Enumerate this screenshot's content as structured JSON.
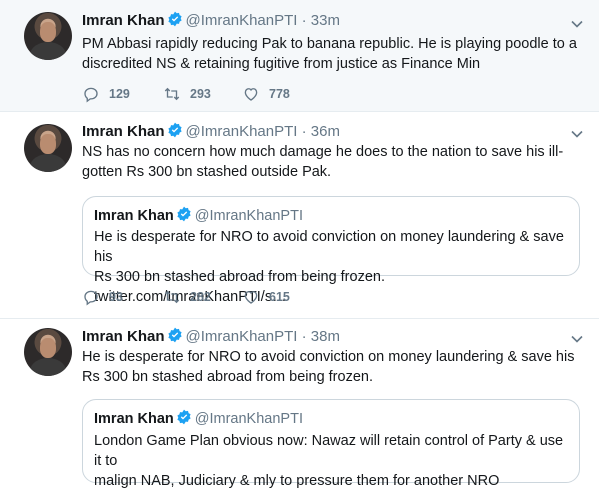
{
  "tweets": [
    {
      "name": "Imran Khan",
      "handle": "@ImranKhanPTI",
      "time": "33m",
      "text_line1": "PM Abbasi rapidly reducing Pak to banana republic. He is playing poodle to a",
      "text_line2": "discredited NS & retaining fugitive from justice as Finance Min",
      "replies": "129",
      "retweets": "293",
      "likes": "778"
    },
    {
      "name": "Imran Khan",
      "handle": "@ImranKhanPTI",
      "time": "36m",
      "text_line1": "NS has no concern how much damage he does to the nation to save his ill-",
      "text_line2": "gotten Rs 300 bn stashed outside Pak.",
      "quote": {
        "name": "Imran Khan",
        "handle": "@ImranKhanPTI",
        "text_line1": "He is desperate for NRO to avoid conviction on money laundering & save his",
        "text_line2": "Rs 300 bn stashed abroad from being frozen. twitter.com/ImranKhanPTI/s…"
      },
      "replies": "93",
      "retweets": "282",
      "likes": "615"
    },
    {
      "name": "Imran Khan",
      "handle": "@ImranKhanPTI",
      "time": "38m",
      "text_line1": "He is desperate for NRO to avoid conviction on money laundering & save his",
      "text_line2": "Rs 300 bn stashed abroad from being frozen.",
      "quote": {
        "name": "Imran Khan",
        "handle": "@ImranKhanPTI",
        "text_line1": "London Game Plan obvious now: Nawaz will retain control of Party & use it to",
        "text_line2": "malign NAB, Judiciary & mly to pressure them for another NRO"
      }
    }
  ],
  "separator": "·",
  "colors": {
    "verified": "#1da1f2",
    "muted": "#657786",
    "highlight_bg": "#f5f8fa"
  },
  "icons": [
    "avatar",
    "verified-badge-icon",
    "chevron-down-icon",
    "reply-icon",
    "retweet-icon",
    "like-icon"
  ]
}
